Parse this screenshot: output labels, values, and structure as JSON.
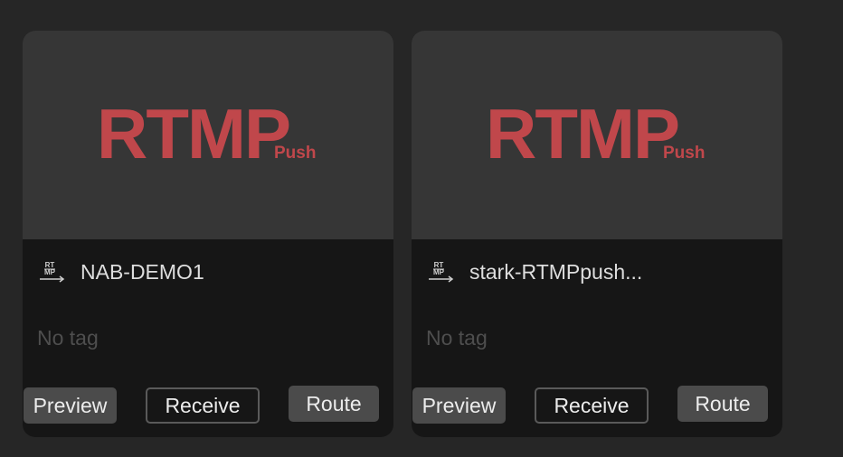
{
  "cards": [
    {
      "logo_main": "RTMP",
      "logo_sub": "Push",
      "type_icon": "rtmp-push-icon",
      "icon_text_top": "RT",
      "icon_text_bottom": "MP",
      "title": "NAB-DEMO1",
      "tag": "No tag",
      "buttons": {
        "preview": "Preview",
        "receive": "Receive",
        "route": "Route"
      }
    },
    {
      "logo_main": "RTMP",
      "logo_sub": "Push",
      "type_icon": "rtmp-push-icon",
      "icon_text_top": "RT",
      "icon_text_bottom": "MP",
      "title": "stark-RTMPpush...",
      "tag": "No tag",
      "buttons": {
        "preview": "Preview",
        "receive": "Receive",
        "route": "Route"
      }
    }
  ],
  "colors": {
    "background": "#262626",
    "card": "#161616",
    "thumbnail": "#363636",
    "logo": "#c0474b",
    "button": "#4b4b4b",
    "text": "#dedede",
    "muted_text": "#4e4e4e"
  }
}
